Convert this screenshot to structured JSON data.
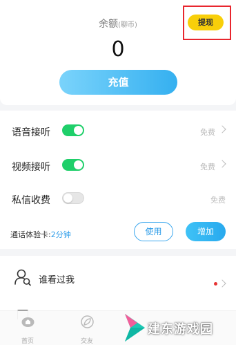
{
  "wallet": {
    "balance_label": "余额",
    "balance_unit": "(聊币)",
    "balance_value": "0",
    "withdraw_label": "提现",
    "recharge_label": "充值"
  },
  "settings": {
    "rows": [
      {
        "label": "语音接听",
        "enabled": true,
        "status": "免费"
      },
      {
        "label": "视频接听",
        "enabled": true,
        "status": "免费"
      },
      {
        "label": "私信收费",
        "enabled": false,
        "status": "免费"
      }
    ],
    "trial_label": "通话体验卡:",
    "trial_minutes": "2分钟",
    "use_label": "使用",
    "add_label": "增加"
  },
  "menu": {
    "items": [
      {
        "label": "谁看过我",
        "icon": "user-search-icon",
        "has_badge": true
      }
    ]
  },
  "tabbar": {
    "tabs": [
      {
        "label": "首页",
        "icon": "home-icon"
      },
      {
        "label": "交友",
        "icon": "leaf-icon"
      }
    ]
  },
  "watermark": {
    "text": "建东游戏园"
  },
  "colors": {
    "accent_blue": "#2a9be8",
    "toggle_on": "#1fcf6a",
    "withdraw_yellow": "#f8cf0a",
    "highlight_red": "#e8262e",
    "badge_red": "#e63434"
  }
}
